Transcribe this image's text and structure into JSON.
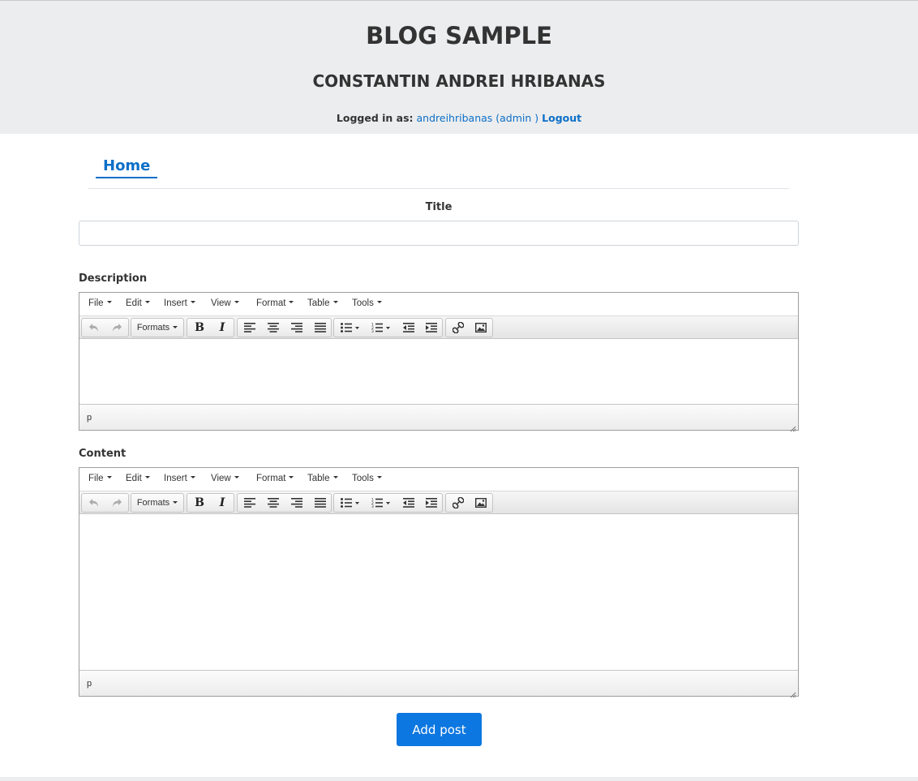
{
  "header": {
    "site_title": "BLOG SAMPLE",
    "author": "CONSTANTIN ANDREI HRIBANAS",
    "logged_in_label": "Logged in as:",
    "user": "andreihribanas (admin )",
    "logout": "Logout"
  },
  "nav": {
    "home": "Home"
  },
  "form": {
    "title_label": "Title",
    "title_value": "",
    "description_label": "Description",
    "content_label": "Content",
    "submit": "Add post"
  },
  "editor": {
    "menu": [
      "File",
      "Edit",
      "Insert",
      "View",
      "Format",
      "Table",
      "Tools"
    ],
    "formats": "Formats",
    "bold": "B",
    "italic": "I",
    "path": "p",
    "tool_icons": [
      "undo-icon",
      "redo-icon",
      "bold-icon",
      "italic-icon",
      "align-left-icon",
      "align-center-icon",
      "align-right-icon",
      "align-justify-icon",
      "bullet-list-icon",
      "numbered-list-icon",
      "outdent-icon",
      "indent-icon",
      "link-icon",
      "image-icon"
    ]
  },
  "colors": {
    "accent": "#0c77e0",
    "link": "#0c6fc8",
    "header_bg": "#ecedee"
  }
}
